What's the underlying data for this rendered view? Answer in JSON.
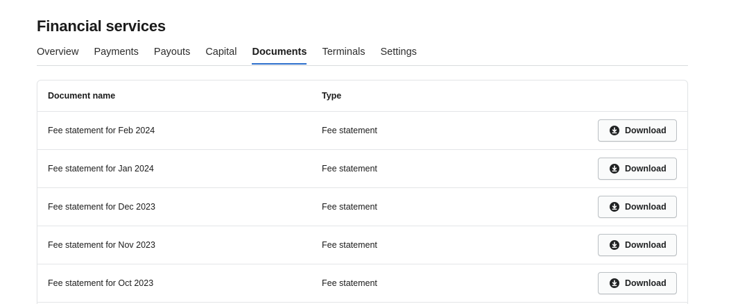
{
  "header": {
    "title": "Financial services"
  },
  "tabs": [
    {
      "label": "Overview",
      "active": false
    },
    {
      "label": "Payments",
      "active": false
    },
    {
      "label": "Payouts",
      "active": false
    },
    {
      "label": "Capital",
      "active": false
    },
    {
      "label": "Documents",
      "active": true
    },
    {
      "label": "Terminals",
      "active": false
    },
    {
      "label": "Settings",
      "active": false
    }
  ],
  "table": {
    "columns": {
      "name": "Document name",
      "type": "Type"
    },
    "rows": [
      {
        "name": "Fee statement for Feb 2024",
        "type": "Fee statement",
        "action": "Download"
      },
      {
        "name": "Fee statement for Jan 2024",
        "type": "Fee statement",
        "action": "Download"
      },
      {
        "name": "Fee statement for Dec 2023",
        "type": "Fee statement",
        "action": "Download"
      },
      {
        "name": "Fee statement for Nov 2023",
        "type": "Fee statement",
        "action": "Download"
      },
      {
        "name": "Fee statement for Oct 2023",
        "type": "Fee statement",
        "action": "Download"
      }
    ]
  },
  "icons": {
    "download": "download-circle-icon"
  },
  "colors": {
    "accent": "#2c6ecb",
    "border": "#e3e5e7",
    "text": "#1a1a1a"
  }
}
